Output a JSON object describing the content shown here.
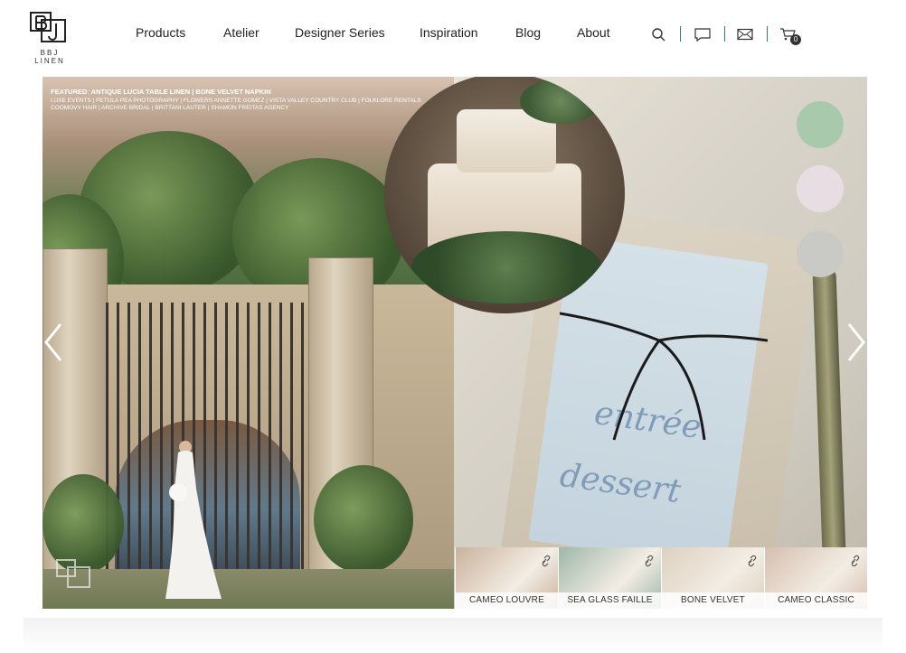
{
  "brand": {
    "name": "BBJ LINEN"
  },
  "nav": {
    "items": [
      "Products",
      "Atelier",
      "Designer Series",
      "Inspiration",
      "Blog",
      "About"
    ]
  },
  "header_icons": {
    "search": "search-icon",
    "chat": "chat-icon",
    "mail": "mail-icon",
    "cart": "cart-icon",
    "cart_count": "0",
    "separator_color": "#2a7f86"
  },
  "hero": {
    "featured_title": "FEATURED: ANTIQUE LUCIA TABLE LINEN | BONE VELVET NAPKIN",
    "credits_line1": "LUXE EVENTS | PETULA PEA PHOTOGRAPHY | FLOWERS ANNETTE GOMEZ | VISTA VALLEY COUNTRY CLUB | FOLKLORE RENTALS",
    "credits_line2": "COOMOVY HAIR | ARCHIVE BRIDAL | BRITTANI LAUTER | SHAMON FREITAS AGENCY",
    "menu_words": [
      "entrée",
      "dessert"
    ],
    "palette": [
      "#a9c9ad",
      "#e8dde3",
      "#c9cac6"
    ],
    "prev_icon": "chevron-left-icon",
    "next_icon": "chevron-right-icon"
  },
  "fabrics": [
    {
      "label": "CAMEO LOUVRE",
      "color": "#c9b29c"
    },
    {
      "label": "SEA GLASS FAILLE",
      "color": "#9fb7a9"
    },
    {
      "label": "BONE VELVET",
      "color": "#ddd0c0"
    },
    {
      "label": "CAMEO CLASSIC",
      "color": "#d6bfb0"
    }
  ]
}
